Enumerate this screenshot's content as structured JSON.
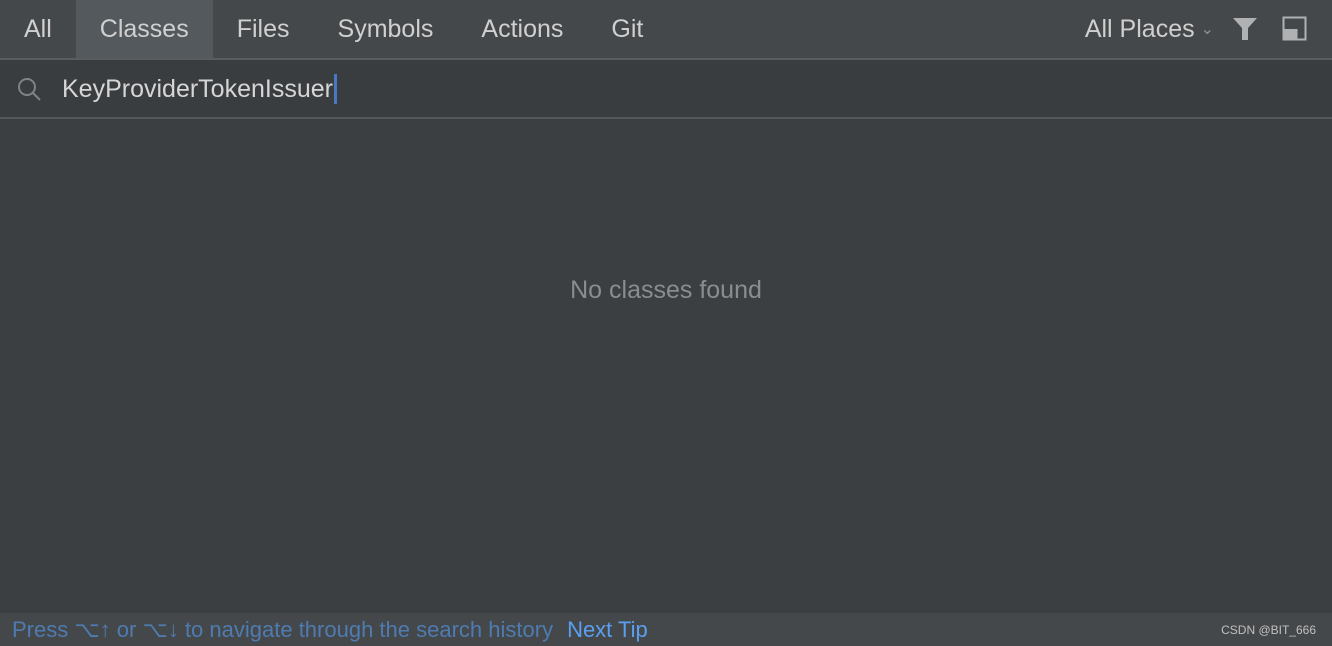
{
  "tabs": [
    {
      "label": "All"
    },
    {
      "label": "Classes"
    },
    {
      "label": "Files"
    },
    {
      "label": "Symbols"
    },
    {
      "label": "Actions"
    },
    {
      "label": "Git"
    }
  ],
  "scope": {
    "label": "All Places"
  },
  "search": {
    "value": "KeyProviderTokenIssuer"
  },
  "results": {
    "empty_text": "No classes found"
  },
  "footer": {
    "hint": "Press ⌥↑ or ⌥↓ to navigate through the search history",
    "next_tip": "Next Tip",
    "watermark": "CSDN @BIT_666"
  },
  "colors": {
    "accent": "#5a9ff0",
    "caret": "#4a78c2"
  }
}
